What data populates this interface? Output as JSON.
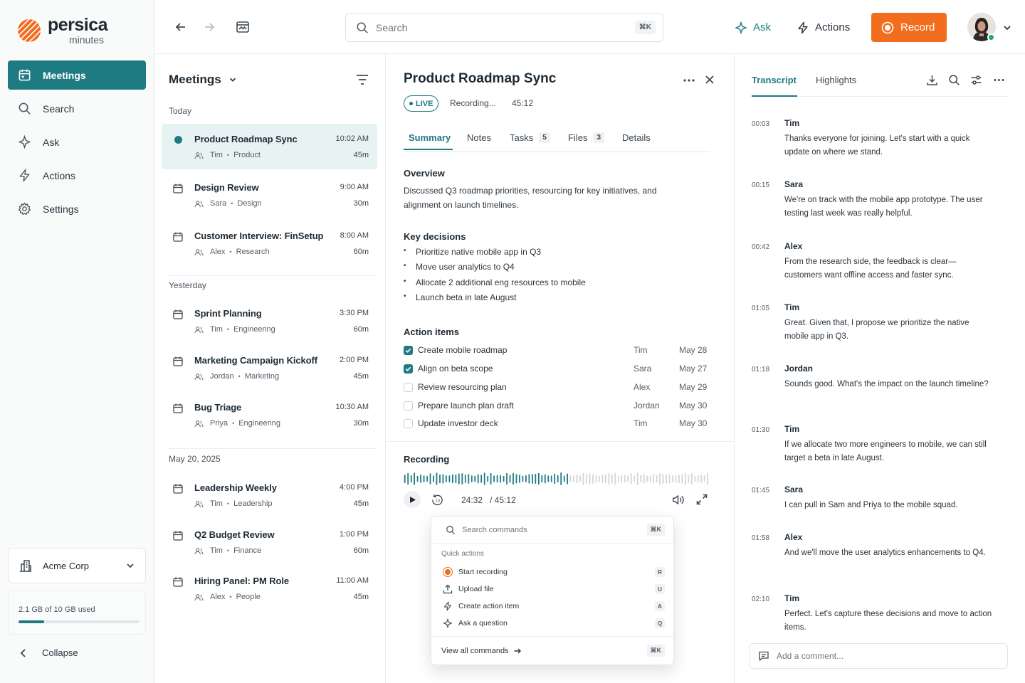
{
  "brand": {
    "name": "persica",
    "sub": "minutes",
    "accent": "#1f7b82",
    "record_color": "#f26d1e"
  },
  "sidebar": {
    "items": [
      {
        "label": "Meetings",
        "icon": "calendar-icon",
        "active": true
      },
      {
        "label": "Search",
        "icon": "search-icon"
      },
      {
        "label": "Ask",
        "icon": "sparkle-icon"
      },
      {
        "label": "Actions",
        "icon": "lightning-icon"
      },
      {
        "label": "Settings",
        "icon": "gear-icon"
      }
    ],
    "org": "Acme Corp",
    "storage_text": "2.1 GB of 10 GB used",
    "storage_fraction": 0.21,
    "collapse_label": "Collapse"
  },
  "topbar": {
    "search_placeholder": "Search",
    "search_shortcut": "⌘K",
    "ask_label": "Ask",
    "actions_label": "Actions",
    "record_label": "Record"
  },
  "meetings": {
    "heading": "Meetings",
    "groups": [
      {
        "label": "Today",
        "items": [
          {
            "title": "Product Roadmap Sync",
            "owner": "Tim",
            "team": "Product",
            "time": "10:02 AM",
            "duration": "45m",
            "live": true
          },
          {
            "title": "Design Review",
            "owner": "Sara",
            "team": "Design",
            "time": "9:00 AM",
            "duration": "30m"
          },
          {
            "title": "Customer Interview: FinSetup",
            "owner": "Alex",
            "team": "Research",
            "time": "8:00 AM",
            "duration": "60m"
          }
        ]
      },
      {
        "label": "Yesterday",
        "items": [
          {
            "title": "Sprint Planning",
            "owner": "Tim",
            "team": "Engineering",
            "time": "3:30 PM",
            "duration": "60m"
          },
          {
            "title": "Marketing Campaign Kickoff",
            "owner": "Jordan",
            "team": "Marketing",
            "time": "2:00 PM",
            "duration": "45m"
          },
          {
            "title": "Bug Triage",
            "owner": "Priya",
            "team": "Engineering",
            "time": "10:30 AM",
            "duration": "30m"
          }
        ]
      },
      {
        "label": "May 20, 2025",
        "items": [
          {
            "title": "Leadership Weekly",
            "owner": "Tim",
            "team": "Leadership",
            "time": "4:00 PM",
            "duration": "45m"
          },
          {
            "title": "Q2 Budget Review",
            "owner": "Tim",
            "team": "Finance",
            "time": "1:00 PM",
            "duration": "60m"
          },
          {
            "title": "Hiring Panel: PM Role",
            "owner": "Alex",
            "team": "People",
            "time": "11:00 AM",
            "duration": "45m"
          }
        ]
      }
    ]
  },
  "detail": {
    "title": "Product Roadmap Sync",
    "live_label": "LIVE",
    "recording_status": "Recording...",
    "elapsed": "45:12",
    "tabs": [
      {
        "label": "Summary",
        "active": true
      },
      {
        "label": "Notes"
      },
      {
        "label": "Tasks",
        "count": "5"
      },
      {
        "label": "Files",
        "count": "3"
      },
      {
        "label": "Details"
      }
    ],
    "overview_title": "Overview",
    "overview_text": "Discussed Q3 roadmap priorities, resourcing for key initiatives, and alignment on launch timelines.",
    "decisions_title": "Key decisions",
    "decisions": [
      "Prioritize native mobile app in Q3",
      "Move user analytics to Q4",
      "Allocate 2 additional eng resources to mobile",
      "Launch beta in late August"
    ],
    "action_items_title": "Action items",
    "action_items": [
      {
        "text": "Create mobile roadmap",
        "owner": "Tim",
        "date": "May 28",
        "done": true
      },
      {
        "text": "Align on beta scope",
        "owner": "Sara",
        "date": "May 27",
        "done": true
      },
      {
        "text": "Review resourcing plan",
        "owner": "Alex",
        "date": "May 29",
        "done": false
      },
      {
        "text": "Prepare launch plan draft",
        "owner": "Jordan",
        "date": "May 30",
        "done": false
      },
      {
        "text": "Update investor deck",
        "owner": "Tim",
        "date": "May 30",
        "done": false
      }
    ],
    "recording_title": "Recording",
    "player": {
      "current": "24:32",
      "total": "/ 45:12",
      "progress_fraction": 0.54
    }
  },
  "palette": {
    "placeholder": "Search commands",
    "shortcut": "⌘K",
    "group_label": "Quick actions",
    "items": [
      {
        "label": "Start recording",
        "key": "R",
        "icon": "record-icon"
      },
      {
        "label": "Upload file",
        "key": "U",
        "icon": "upload-icon"
      },
      {
        "label": "Create action item",
        "key": "A",
        "icon": "lightning-icon"
      },
      {
        "label": "Ask a question",
        "key": "Q",
        "icon": "sparkle-icon"
      }
    ],
    "footer_label": "View all commands",
    "footer_shortcut": "⌘K"
  },
  "transcript": {
    "tabs": [
      {
        "label": "Transcript",
        "active": true
      },
      {
        "label": "Highlights"
      }
    ],
    "entries": [
      {
        "time": "00:03",
        "speaker": "Tim",
        "text": "Thanks everyone for joining. Let's start with a quick update on where we stand."
      },
      {
        "time": "00:15",
        "speaker": "Sara",
        "text": "We're on track with the mobile app prototype. The user testing last week was really helpful."
      },
      {
        "time": "00:42",
        "speaker": "Alex",
        "text": "From the research side, the feedback is clear—customers want offline access and faster sync."
      },
      {
        "time": "01:05",
        "speaker": "Tim",
        "text": "Great. Given that, I propose we prioritize the native mobile app in Q3."
      },
      {
        "time": "01:18",
        "speaker": "Jordan",
        "text": "Sounds good. What's the impact on the launch timeline?"
      },
      {
        "time": "01:30",
        "speaker": "Tim",
        "text": "If we allocate two more engineers to mobile, we can still target a beta in late August."
      },
      {
        "time": "01:45",
        "speaker": "Sara",
        "text": "I can pull in Sam and Priya to the mobile squad."
      },
      {
        "time": "01:58",
        "speaker": "Alex",
        "text": "And we'll move the user analytics enhancements to Q4."
      },
      {
        "time": "02:10",
        "speaker": "Tim",
        "text": "Perfect. Let's capture these decisions and move to action items."
      }
    ],
    "comment_placeholder": "Add a comment..."
  }
}
